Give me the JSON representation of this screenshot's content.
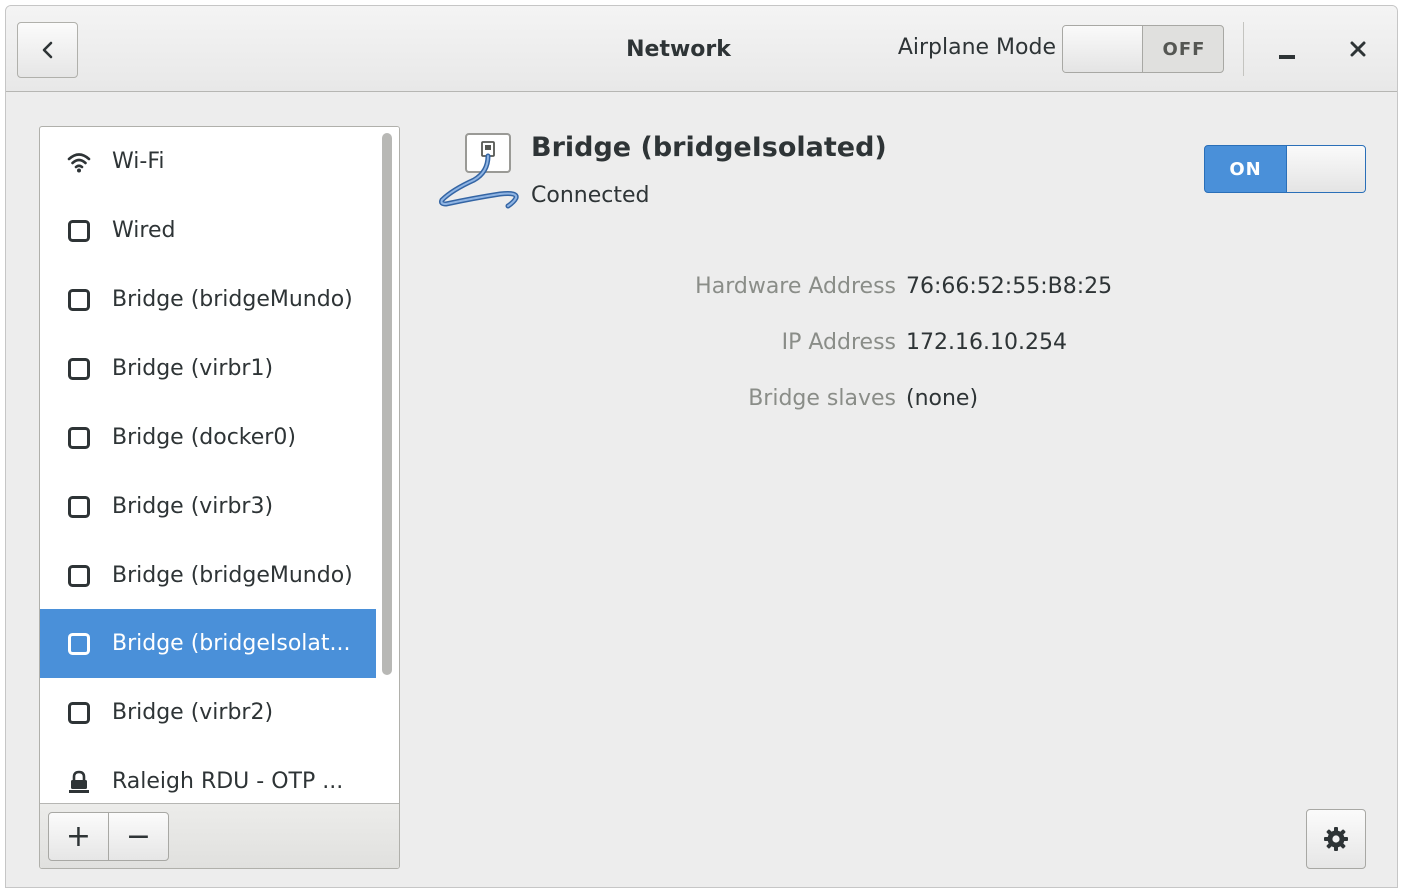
{
  "window": {
    "title": "Network"
  },
  "header": {
    "back_icon": "chevron-left-icon",
    "airplane_mode": {
      "label": "Airplane Mode",
      "state": "OFF"
    },
    "minimize_icon": "minimize-icon",
    "close_icon": "close-icon"
  },
  "sidebar": {
    "items": [
      {
        "label": "Wi-Fi",
        "icon": "wifi-icon",
        "selected": false
      },
      {
        "label": "Wired",
        "icon": "wired-icon",
        "selected": false
      },
      {
        "label": "Bridge (bridgeMundo)",
        "icon": "wired-icon",
        "selected": false
      },
      {
        "label": "Bridge (virbr1)",
        "icon": "wired-icon",
        "selected": false
      },
      {
        "label": "Bridge (docker0)",
        "icon": "wired-icon",
        "selected": false
      },
      {
        "label": "Bridge (virbr3)",
        "icon": "wired-icon",
        "selected": false
      },
      {
        "label": "Bridge (bridgeMundo)",
        "icon": "wired-icon",
        "selected": false
      },
      {
        "label": "Bridge (bridgeIsolat...",
        "icon": "wired-icon",
        "selected": true
      },
      {
        "label": "Bridge (virbr2)",
        "icon": "wired-icon",
        "selected": false
      },
      {
        "label": "Raleigh RDU - OTP ...",
        "icon": "vpn-lock-icon",
        "selected": false
      }
    ],
    "add_label": "+",
    "remove_label": "−"
  },
  "detail": {
    "icon": "network-cable-icon",
    "name": "Bridge (bridgeIsolated)",
    "status": "Connected",
    "switch_state": "ON",
    "rows": [
      {
        "label": "Hardware Address",
        "value": "76:66:52:55:B8:25"
      },
      {
        "label": "IP Address",
        "value": "172.16.10.254"
      },
      {
        "label": "Bridge slaves",
        "value": "(none)"
      }
    ],
    "options_icon": "gear-icon"
  },
  "colors": {
    "accent": "#4a90d9",
    "window_bg": "#ededed",
    "text": "#2e3436",
    "dim_text": "#8a8d88"
  }
}
